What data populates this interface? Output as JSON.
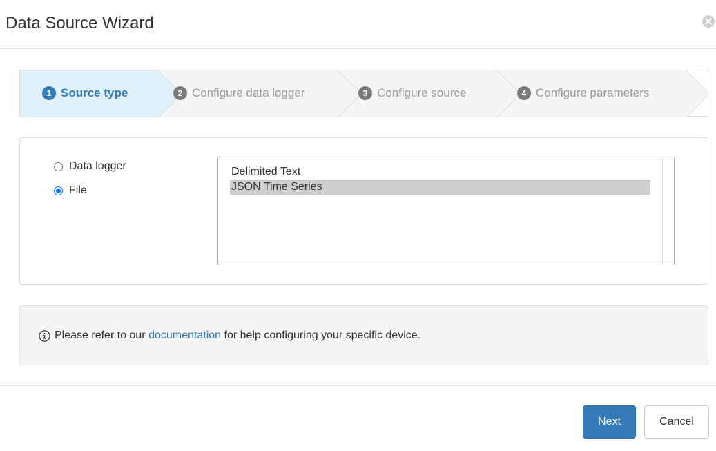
{
  "dialog": {
    "title": "Data Source Wizard",
    "close_icon": "close-circle-icon"
  },
  "steps": [
    {
      "number": "1",
      "label": "Source type",
      "state": "active"
    },
    {
      "number": "2",
      "label": "Configure data logger",
      "state": "inactive"
    },
    {
      "number": "3",
      "label": "Configure source",
      "state": "inactive"
    },
    {
      "number": "4",
      "label": "Configure parameters",
      "state": "inactive"
    }
  ],
  "source_panel": {
    "radio_options": [
      {
        "label": "Data logger",
        "checked": false
      },
      {
        "label": "File",
        "checked": true
      }
    ],
    "file_types": [
      {
        "label": "Delimited Text",
        "selected": false
      },
      {
        "label": "JSON Time Series",
        "selected": true
      }
    ]
  },
  "info": {
    "icon": "info-circle-icon",
    "prefix": "Please refer to our",
    "link_text": "documentation",
    "suffix": "for help configuring your specific device."
  },
  "footer": {
    "next_label": "Next",
    "cancel_label": "Cancel"
  },
  "colors": {
    "primary": "#337ab7",
    "active_step_bg": "#dff0f8",
    "inactive_step_bg": "#f5f5f5",
    "selected_option_bg": "#cecece",
    "radio_checked": "#0075ff"
  }
}
